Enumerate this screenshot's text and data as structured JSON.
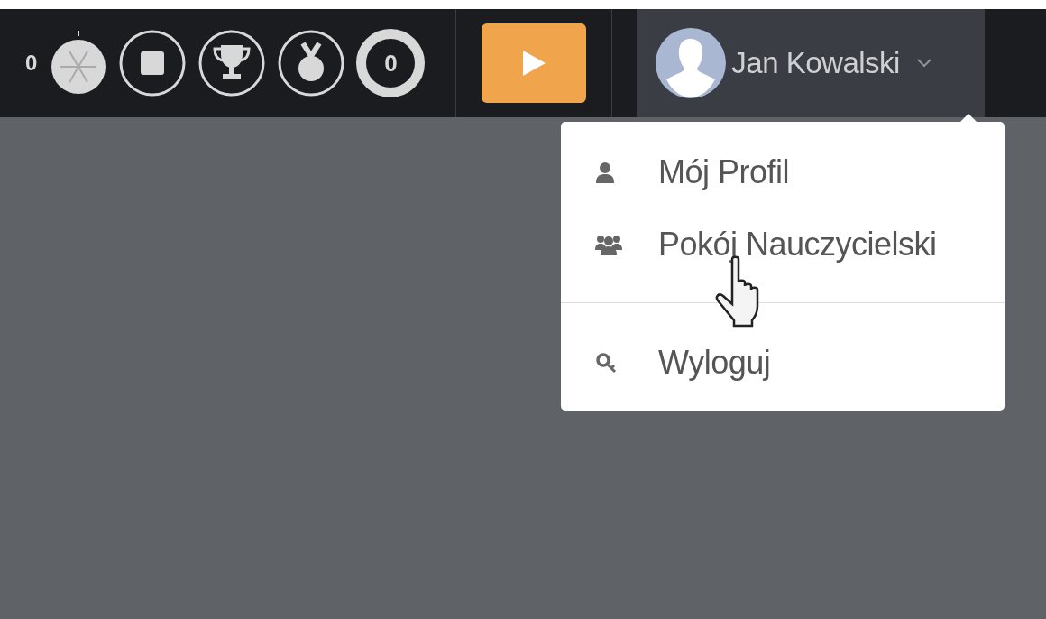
{
  "toolbar": {
    "counter": "0",
    "badges": [
      {
        "kind": "wheel"
      },
      {
        "kind": "stop"
      },
      {
        "kind": "trophy"
      },
      {
        "kind": "medal"
      },
      {
        "kind": "lifebuoy",
        "count": "0"
      }
    ]
  },
  "play_button": {
    "kind": "play"
  },
  "user_menu": {
    "name": "Jan Kowalski",
    "expanded": true,
    "items": [
      {
        "kind": "profile",
        "label": "Mój Profil",
        "divider_before": false
      },
      {
        "kind": "group",
        "label": "Pokój Nauczycielski",
        "divider_before": false
      },
      {
        "kind": "logout",
        "label": "Wyloguj",
        "divider_before": true
      }
    ]
  },
  "cursor": {
    "kind": "hand"
  }
}
